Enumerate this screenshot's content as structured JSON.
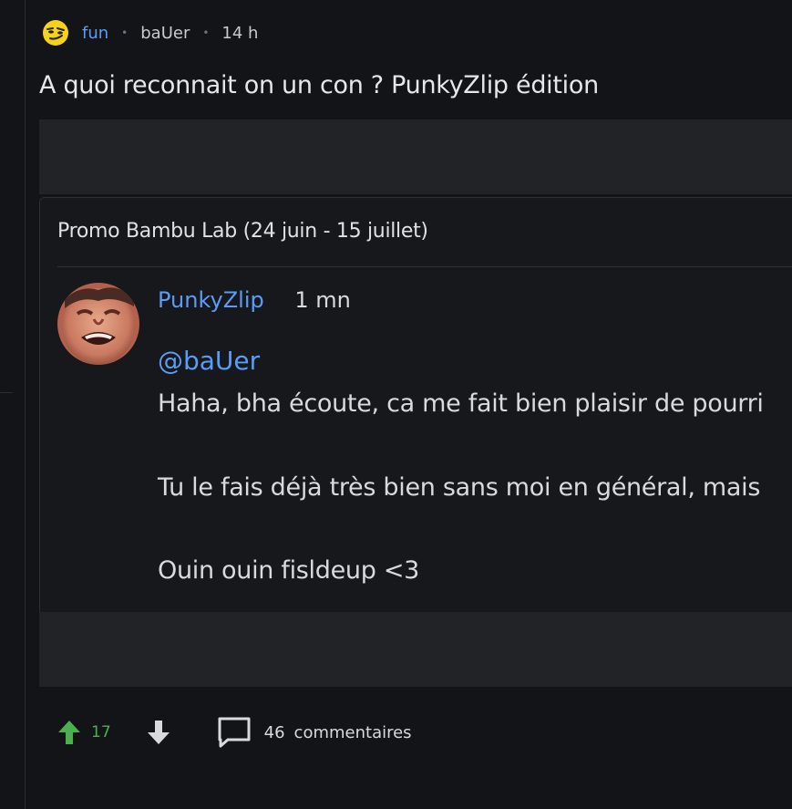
{
  "post": {
    "community": "fun",
    "author": "baUer",
    "age": "14 h",
    "title": "A quoi reconnait on un con ? PunkyZlip édition"
  },
  "embed": {
    "header": "Promo Bambu Lab (24 juin - 15 juillet)",
    "comment": {
      "author": "PunkyZlip",
      "age": "1 mn",
      "mention": "@baUer",
      "lines": [
        "Haha, bha écoute, ca me fait bien plaisir de pourri",
        "Tu le fais déjà très bien sans moi en général, mais",
        "Ouin ouin fisldeup <3"
      ]
    }
  },
  "actions": {
    "upvotes": "17",
    "comments_count": "46",
    "comments_label": "commentaires"
  },
  "icons": {
    "community": "smirking-face-emoji",
    "upvote": "arrow-up-icon",
    "downvote": "arrow-down-icon",
    "comments": "speech-bubble-icon"
  },
  "colors": {
    "background": "#131417",
    "link": "#5b9cf6",
    "upvote": "#4caf50",
    "band": "#222327"
  }
}
